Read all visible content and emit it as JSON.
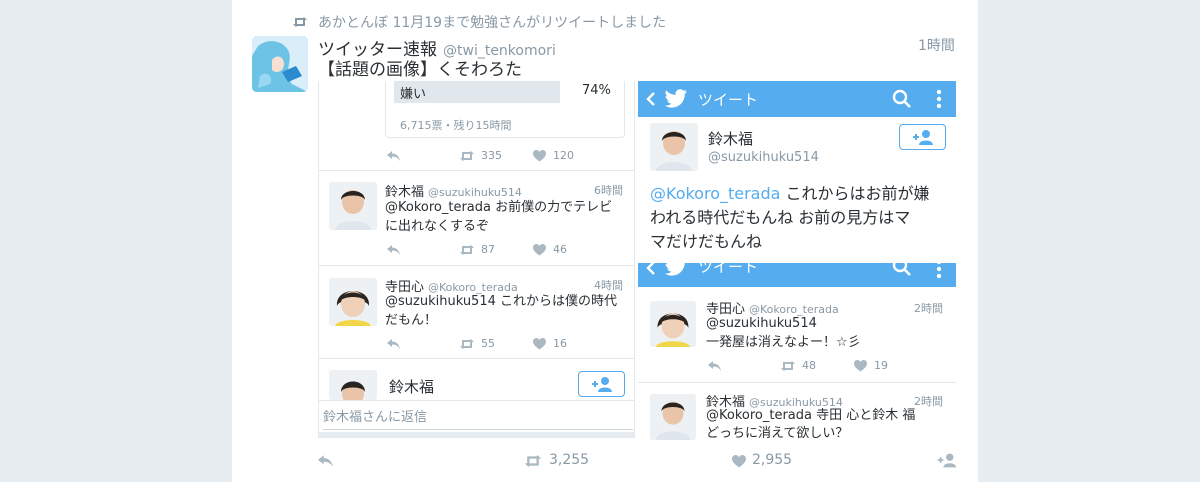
{
  "retweet_line": {
    "text": "あかとんぼ 11月19まで勉強さんがリツイートしました"
  },
  "tweet": {
    "display_name": "ツイッター速報",
    "handle": "@twi_tenkomori",
    "time": "1時間",
    "text": "【話題の画像】くそわろた",
    "retweets": "3,255",
    "likes": "2,955"
  },
  "left_panel": {
    "poll": {
      "option": "嫌い",
      "percent": "74%",
      "meta": "6,715票・残り15時間"
    },
    "poll_actions": {
      "retweets": "335",
      "likes": "120"
    },
    "tweet1": {
      "name": "鈴木福",
      "handle": "@suzukihuku514",
      "time": "6時間",
      "text_line1": "@Kokoro_terada お前僕の力でテレビ",
      "text_line2": "に出れなくするぞ",
      "retweets": "87",
      "likes": "46"
    },
    "tweet2": {
      "name": "寺田心",
      "handle": "@Kokoro_terada",
      "time": "4時間",
      "text_line1": "@suzukihuku514 これからは僕の時代",
      "text_line2": "だもん！",
      "retweets": "55",
      "likes": "16"
    },
    "bottom_profile": {
      "name": "鈴木福"
    },
    "reply_placeholder": "鈴木福さんに返信"
  },
  "right_top": {
    "header_title": "ツイート",
    "name": "鈴木福",
    "handle": "@suzukihuku514",
    "mention": "@Kokoro_terada",
    "text_line1_rest": " これからはお前が嫌",
    "text_line2": "われる時代だもんね お前の見方はマ",
    "text_line3": "マだけだもんね"
  },
  "right_bottom": {
    "header_title": "ツイート",
    "tweet1": {
      "name": "寺田心",
      "handle": "@Kokoro_terada",
      "time": "2時間",
      "text_line1": "@suzukihuku514",
      "text_line2": "一発屋は消えなよー！☆彡",
      "retweets": "48",
      "likes": "19"
    },
    "tweet2": {
      "name": "鈴木福",
      "handle": "@suzukihuku514",
      "time": "2時間",
      "text_line1": "@Kokoro_terada 寺田 心と鈴木 福",
      "text_line2": "どっちに消えて欲しい？"
    }
  },
  "colors": {
    "accent": "#55acee",
    "muted": "#8899a6",
    "text": "#292f33"
  },
  "icons": [
    "retweet-icon",
    "reply-icon",
    "heart-icon",
    "follow-icon",
    "back-chevron-icon",
    "twitter-bird-icon",
    "search-icon",
    "more-vertical-icon"
  ]
}
